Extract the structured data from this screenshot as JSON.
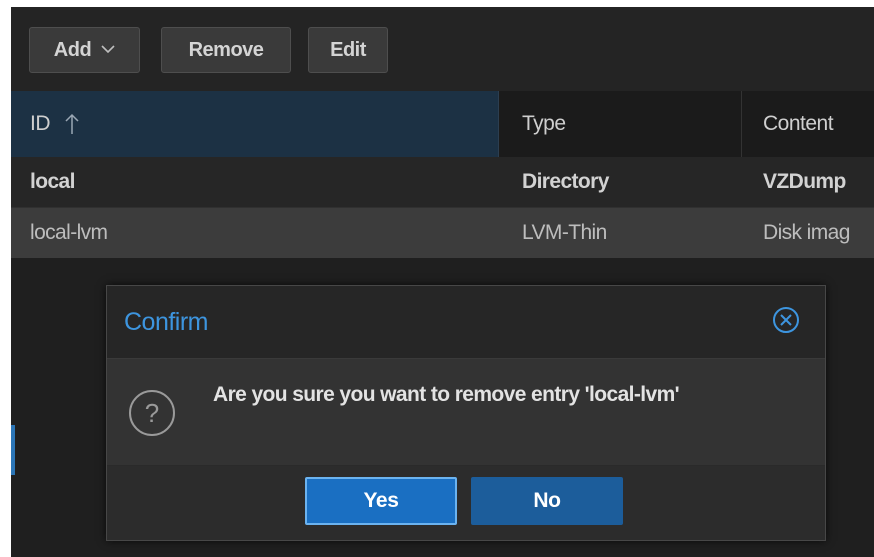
{
  "toolbar": {
    "add_label": "Add",
    "remove_label": "Remove",
    "edit_label": "Edit"
  },
  "table": {
    "columns": [
      {
        "label": "ID",
        "sort": "ascending"
      },
      {
        "label": "Type"
      },
      {
        "label": "Content"
      }
    ],
    "rows": [
      {
        "id": "local",
        "type": "Directory",
        "content": "VZDump"
      },
      {
        "id": "local-lvm",
        "type": "LVM-Thin",
        "content": "Disk imag",
        "selected": true
      }
    ]
  },
  "dialog": {
    "title": "Confirm",
    "message": "Are you sure you want to remove entry 'local-lvm'",
    "yes_label": "Yes",
    "no_label": "No"
  },
  "icons": {
    "sort": "arrow-up-icon",
    "dropdown": "chevron-down-icon",
    "close": "close-circle-icon",
    "question": "question-circle-icon"
  },
  "colors": {
    "accent": "#3d95df",
    "primary_button": "#1a6fc2",
    "secondary_button": "#1c5d9b",
    "header_selected": "#1c3144",
    "row_selected": "#3c3c3c"
  }
}
